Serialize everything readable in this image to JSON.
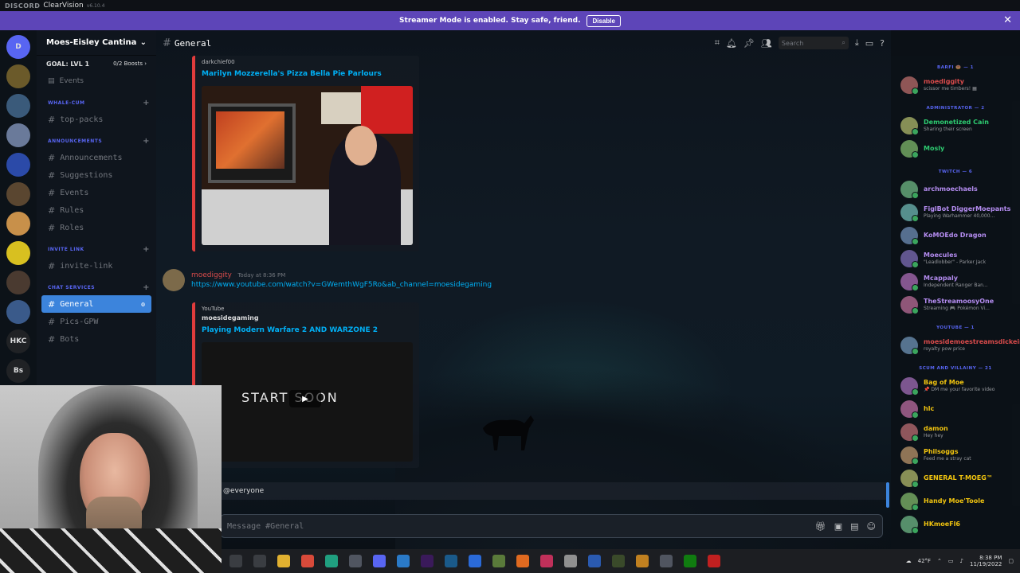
{
  "titlebar": {
    "brand": "DISCORD",
    "app": "ClearVision",
    "version": "v6.10.4"
  },
  "streamer_bar": {
    "message": "Streamer Mode is enabled. Stay safe, friend.",
    "button": "Disable",
    "close": "✕"
  },
  "guilds": [
    {
      "label": "D",
      "icon": "discord-logo-icon",
      "color": "#5865f2"
    },
    {
      "label": "",
      "icon": "server-icon",
      "color": "#6b5a2a"
    },
    {
      "label": "",
      "icon": "server-icon",
      "color": "#3a5a7a"
    },
    {
      "label": "",
      "icon": "server-icon",
      "color": "#6a7a9a"
    },
    {
      "label": "",
      "icon": "folder-icon",
      "color": "#2b4aa8"
    },
    {
      "label": "",
      "icon": "server-icon",
      "color": "#5a4630"
    },
    {
      "label": "",
      "icon": "server-icon",
      "color": "#c8904a"
    },
    {
      "label": "",
      "icon": "server-icon",
      "color": "#d8c020"
    },
    {
      "label": "",
      "icon": "server-icon",
      "color": "#4a3a30"
    },
    {
      "label": "",
      "icon": "server-icon",
      "color": "#3a5a8a"
    },
    {
      "label": "HKC",
      "icon": "server-icon",
      "color": "#202225"
    },
    {
      "label": "Bs",
      "icon": "server-icon",
      "color": "#202225"
    }
  ],
  "server": {
    "name": "Moes-Eisley Cantina",
    "goal_label": "GOAL: LVL 1",
    "goal_boosts": "0/2 Boosts ›",
    "events": "Events",
    "categories": [
      {
        "name": "WHALE-CUM",
        "channels": [
          "top-packs"
        ]
      },
      {
        "name": "ANNOUNCEMENTS",
        "channels": [
          "Announcements",
          "Suggestions",
          "Events",
          "Rules",
          "Roles"
        ]
      },
      {
        "name": "INVITE LINK",
        "channels": [
          "invite-link"
        ]
      },
      {
        "name": "CHAT SERVICES",
        "channels": [
          "General",
          "Pics-GPW",
          "Bots"
        ]
      }
    ]
  },
  "channel": {
    "name": "General",
    "search_placeholder": "Search",
    "input_placeholder": "Message #General",
    "mention": "@everyone"
  },
  "messages": {
    "embed1": {
      "provider": "darkchief00",
      "title": "Marilyn Mozzerella's Pizza Bella Pie Parlours"
    },
    "post": {
      "author": "moediggity",
      "time": "Today at 8:36 PM",
      "link": "https://www.youtube.com/watch?v=GWemthWgF5Ro&ab_channel=moesidegaming"
    },
    "embed2": {
      "provider": "YouTube",
      "author": "moesidegaming",
      "title": "Playing Modern Warfare 2 AND WARZONE 2",
      "overlay": "START SOON"
    }
  },
  "members": {
    "groups": [
      {
        "name": "BARFI 🍩 — 1",
        "items": [
          {
            "name": "moediggity",
            "status": "scissor me timbers! ▦",
            "color": "#d94b4b"
          }
        ]
      },
      {
        "name": "ADMINISTRATOR — 2",
        "items": [
          {
            "name": "Demonetized Cain",
            "status": "Sharing their screen",
            "color": "#2ecc71"
          },
          {
            "name": "Mosly",
            "status": "",
            "color": "#2ecc71"
          }
        ]
      },
      {
        "name": "TWITCH — 6",
        "items": [
          {
            "name": "archmoechaels",
            "status": "",
            "color": "#b48cf0"
          },
          {
            "name": "FiglBot DiggerMoepants",
            "status": "Playing Warhammer 40,000...",
            "color": "#b48cf0"
          },
          {
            "name": "KoMOEdo Dragon",
            "status": "",
            "color": "#b48cf0"
          },
          {
            "name": "Moecules",
            "status": "\"Leadlobber\" - Parker Jack",
            "color": "#b48cf0"
          },
          {
            "name": "Mcappaly",
            "status": "Independent Ranger Ban...",
            "color": "#b48cf0"
          },
          {
            "name": "TheStreamoosyOne",
            "status": "Streaming 🎮 Pokémon Vi...",
            "color": "#b48cf0"
          }
        ]
      },
      {
        "name": "YOUTUBE — 1",
        "items": [
          {
            "name": "moesidemoestreamsdickeinsin",
            "status": "royalty pow price",
            "color": "#d94b4b"
          }
        ]
      },
      {
        "name": "SCUM AND VILLAINY — 21",
        "items": [
          {
            "name": "Bag of Moe",
            "status": "📌 DM me your favorite video",
            "color": "#f1c40f"
          },
          {
            "name": "hlc",
            "status": "",
            "color": "#f1c40f"
          },
          {
            "name": "damon",
            "status": "Hey hey",
            "color": "#f1c40f"
          },
          {
            "name": "Philsoggs",
            "status": "Feed me a stray cat",
            "color": "#f1c40f"
          },
          {
            "name": "GENERAL T-MOEG™",
            "status": "",
            "color": "#f1c40f"
          },
          {
            "name": "Handy Moe'Toole",
            "status": "",
            "color": "#f1c40f"
          },
          {
            "name": "HKmoeFl6",
            "status": "",
            "color": "#f1c40f"
          }
        ]
      }
    ]
  },
  "taskbar": {
    "icons": [
      {
        "icon": "search-icon",
        "color": "#3a3d42"
      },
      {
        "icon": "task-view-icon",
        "color": "#3a3d42"
      },
      {
        "icon": "file-explorer-icon",
        "color": "#e0b030"
      },
      {
        "icon": "chrome-icon",
        "color": "#d84a3a"
      },
      {
        "icon": "app-icon",
        "color": "#20a080"
      },
      {
        "icon": "app-icon",
        "color": "#505560"
      },
      {
        "icon": "discord-icon",
        "color": "#5865f2"
      },
      {
        "icon": "app-icon",
        "color": "#2a7ac8"
      },
      {
        "icon": "premiere-icon",
        "color": "#3a1a5a"
      },
      {
        "icon": "app-icon",
        "color": "#1a5a8a"
      },
      {
        "icon": "app-icon",
        "color": "#2a6ad8"
      },
      {
        "icon": "app-icon",
        "color": "#5a7a3a"
      },
      {
        "icon": "app-icon",
        "color": "#e06a20"
      },
      {
        "icon": "app-icon",
        "color": "#c0305a"
      },
      {
        "icon": "app-icon",
        "color": "#909090"
      },
      {
        "icon": "app-icon",
        "color": "#2a5ab0"
      },
      {
        "icon": "app-icon",
        "color": "#3a4a2a"
      },
      {
        "icon": "app-icon",
        "color": "#c08020"
      },
      {
        "icon": "app-icon",
        "color": "#505560"
      },
      {
        "icon": "xbox-icon",
        "color": "#107c10"
      },
      {
        "icon": "app-icon",
        "color": "#c02020"
      }
    ],
    "temperature": "42°F",
    "time": "8:38 PM",
    "date": "11/19/2022"
  }
}
